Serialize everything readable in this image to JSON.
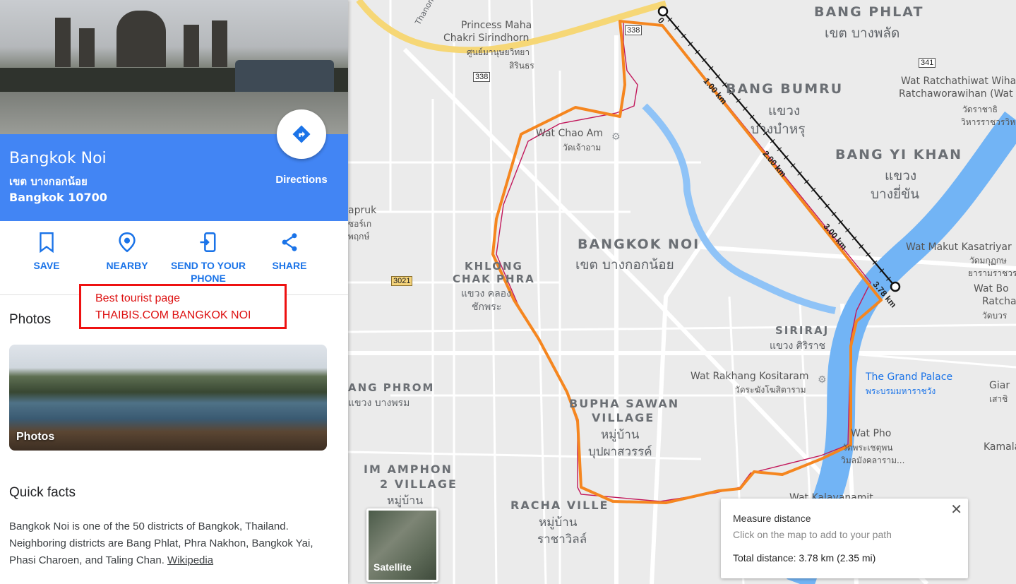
{
  "place": {
    "title": "Bangkok Noi",
    "thai_name": "เขต บางกอกน้อย",
    "postal": "Bangkok 10700",
    "directions_label": "Directions"
  },
  "actions": [
    {
      "label": "SAVE",
      "icon": "bookmark-icon"
    },
    {
      "label": "NEARBY",
      "icon": "location-pin-icon"
    },
    {
      "label": "SEND TO YOUR PHONE",
      "icon": "send-to-phone-icon"
    },
    {
      "label": "SHARE",
      "icon": "share-icon"
    }
  ],
  "annotation": {
    "line1": "Best tourist page",
    "line2": "THAIBIS.COM BANGKOK NOI"
  },
  "photos": {
    "heading": "Photos",
    "caption": "Photos"
  },
  "quick_facts": {
    "heading": "Quick facts",
    "text": "Bangkok Noi is one of the 50 districts of Bangkok, Thailand. Neighboring districts are Bang Phlat, Phra Nakhon, Bangkok Yai, Phasi Charoen, and Taling Chan.",
    "link": "Wikipedia"
  },
  "map": {
    "districts": [
      {
        "en": "BANG PHLAT",
        "th": "เขต บางพลัด"
      },
      {
        "en": "BANG BUMRU",
        "th1": "แขวง",
        "th2": "บางบำหรุ"
      },
      {
        "en": "BANG YI KHAN",
        "th1": "แขวง",
        "th2": "บางยี่ขัน"
      },
      {
        "en": "BANGKOK NOI",
        "th": "เขต บางกอกน้อย"
      },
      {
        "en1": "KHLONG",
        "en2": "CHAK PHRA",
        "th1": "แขวง คลอง",
        "th2": "ชักพระ"
      },
      {
        "en": "SIRIRAJ",
        "th": "แขวง ศิริราช"
      },
      {
        "en1": "BUPHA SAWAN",
        "en2": "VILLAGE",
        "th1": "หมู่บ้าน",
        "th2": "บุปผาสวรรค์"
      },
      {
        "en": "ANG PHROM",
        "th": "แขวง บางพรม"
      },
      {
        "en1": "IM AMPHON",
        "en2": "2 VILLAGE",
        "th": "หมู่บ้าน"
      },
      {
        "en": "RACHA VILLE",
        "th1": "หมู่บ้าน",
        "th2": "ราชาวิลล์"
      }
    ],
    "pois": [
      {
        "name": "Princess Maha",
        "name2": "Chakri Sirindhorn",
        "th": "ศูนย์มานุษยวิทยา",
        "th2": "สิรินธร"
      },
      {
        "name": "Wat Chao Am",
        "th": "วัดเจ้าอาม"
      },
      {
        "name": "Wat Rakhang Kositaram",
        "th": "วัดระฆังโฆสิตาราม"
      },
      {
        "name": "Wat Ratchathiwat Wiha",
        "name2": "Ratchaworawihan (Wat",
        "th": "วัดราชาธิ",
        "th2": "วิหารราชวรวิห"
      },
      {
        "name": "Wat Makut Kasatriyar",
        "th": "วัดมกุฏกษ",
        "th2": "ยารามราชวร"
      },
      {
        "name": "Wat Bo",
        "name2": "Ratcha",
        "th": "วัดบวร"
      },
      {
        "name": "The Grand Palace",
        "th": "พระบรมมหาราชวัง"
      },
      {
        "name": "Wat Pho",
        "th": "วัดพระเชตุพน",
        "th2": "วิมลมังคลาราม..."
      },
      {
        "name": "Wat Kalayanamit"
      },
      {
        "name": "Giar",
        "th": "เสาชิ"
      },
      {
        "name": "Kamalaw"
      },
      {
        "name": "apruk",
        "th": "ซอร์เก",
        "th2": "พฤกษ์"
      }
    ],
    "roads": [
      {
        "label": "Thanon R"
      }
    ],
    "shields": [
      "338",
      "338",
      "341",
      "3021"
    ],
    "distance_ticks": [
      "0",
      "1.00 km",
      "2.00 km",
      "3.00 km",
      "3.78 km"
    ],
    "satellite_label": "Satellite",
    "measure": {
      "title": "Measure distance",
      "hint": "Click on the map to add to your path",
      "total": "Total distance: 3.78 km (2.35 mi)"
    },
    "colors": {
      "route": "#f5861f",
      "measure_line": "#111111",
      "boundary": "#c2185b",
      "river": "#72b4f5"
    }
  }
}
